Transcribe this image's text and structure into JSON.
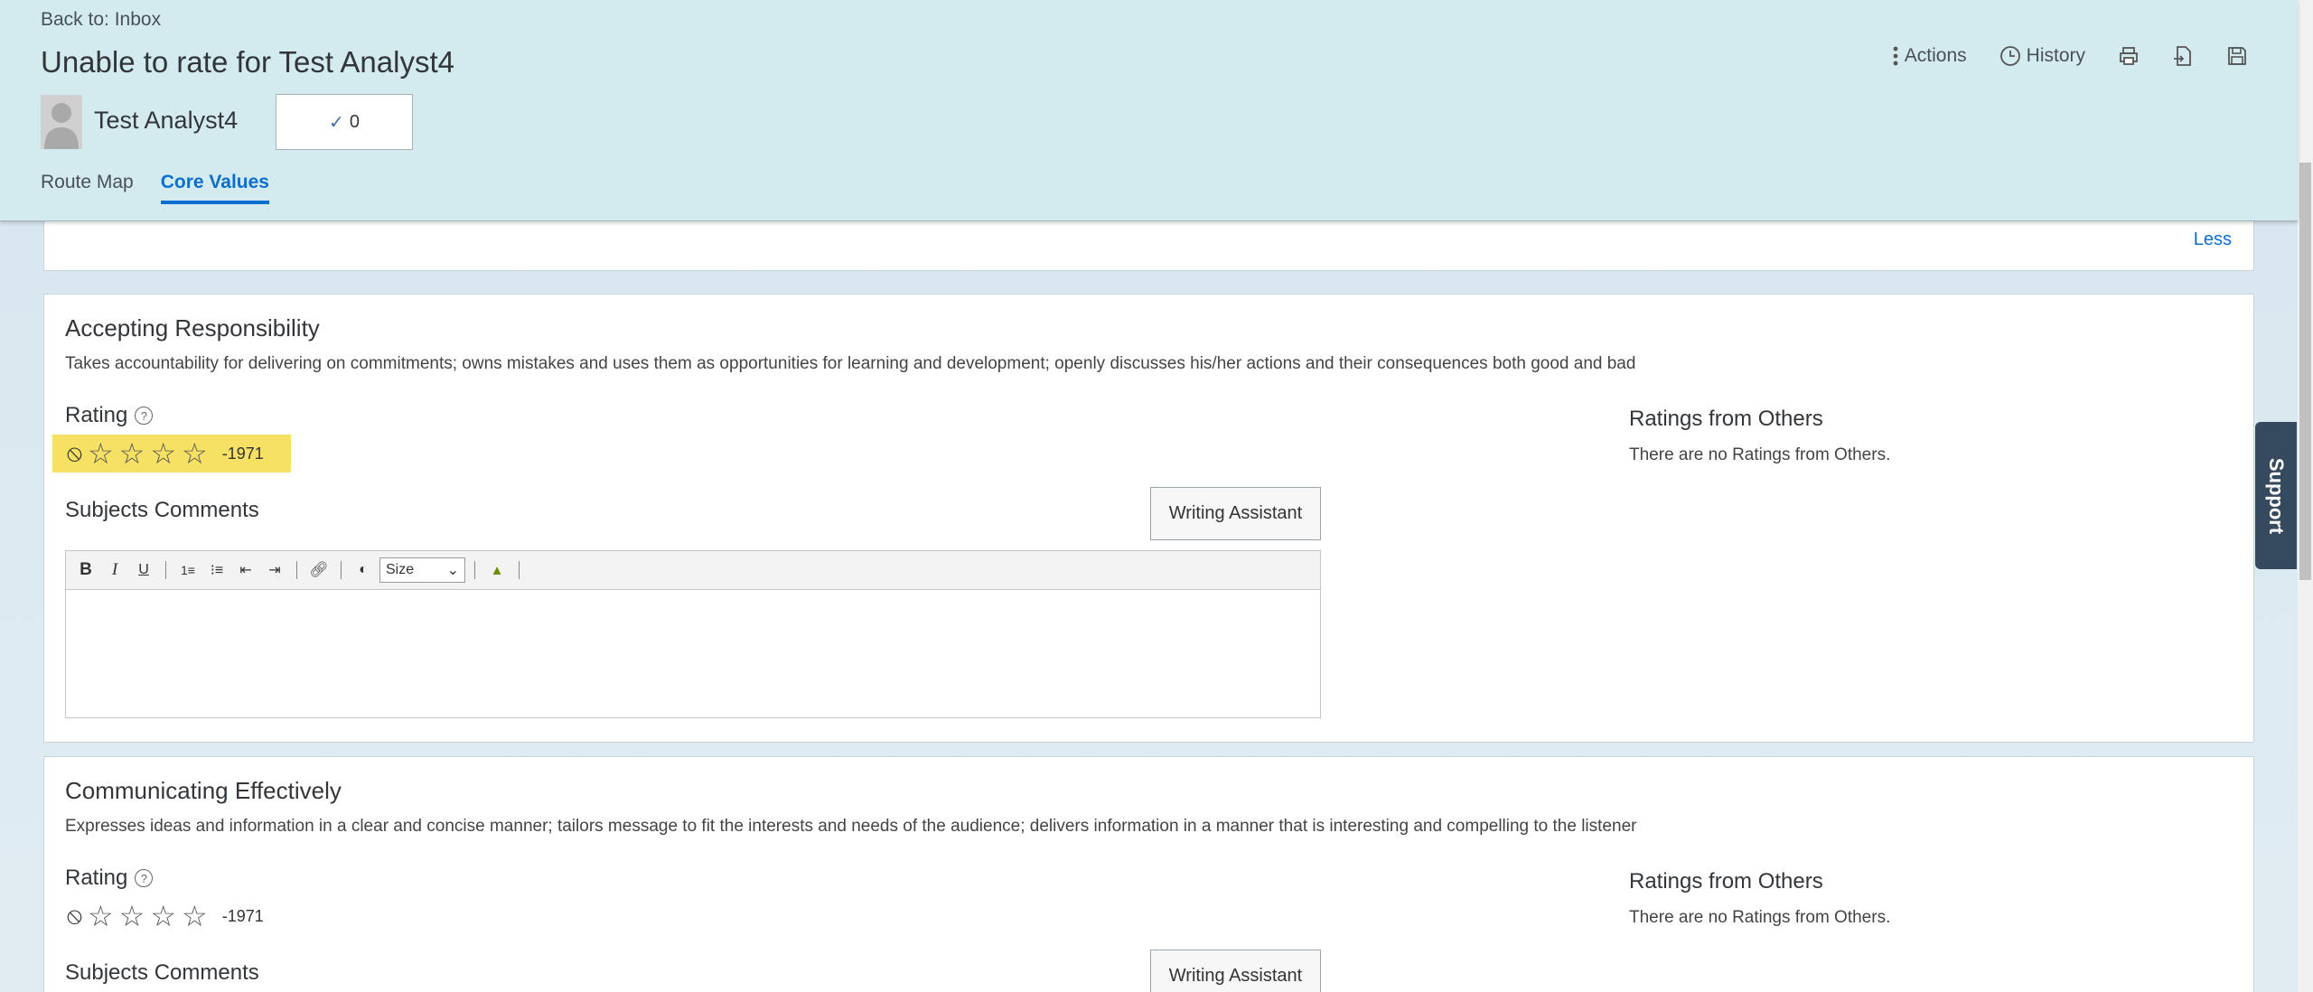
{
  "header": {
    "back_link": "Back to: Inbox",
    "title": "Unable to rate for Test Analyst4",
    "user_name": "Test Analyst4",
    "check_count": "0",
    "tabs": [
      {
        "label": "Route Map",
        "active": false
      },
      {
        "label": "Core Values",
        "active": true
      }
    ],
    "toolbar": {
      "actions_label": "Actions",
      "history_label": "History",
      "print_icon": "print-icon",
      "export_icon": "export-icon",
      "save_icon": "save-icon"
    }
  },
  "top_card": {
    "less_label": "Less"
  },
  "sections": [
    {
      "title": "Accepting Responsibility",
      "description": "Takes accountability for delivering on commitments; owns mistakes and uses them as opportunities for learning and development; openly discusses his/her actions and their consequences both good and bad",
      "rating_label": "Rating",
      "rating_value": "-1971",
      "stars": 5,
      "highlighted": true,
      "comments_label": "Subjects Comments",
      "writing_assistant": "Writing Assistant",
      "size_select": "Size",
      "others_title": "Ratings from Others",
      "others_text": "There are no Ratings from Others."
    },
    {
      "title": "Communicating Effectively",
      "description": "Expresses ideas and information in a clear and concise manner; tailors message to fit the interests and needs of the audience; delivers information in a manner that is interesting and compelling to the listener",
      "rating_label": "Rating",
      "rating_value": "-1971",
      "stars": 5,
      "highlighted": false,
      "comments_label": "Subjects Comments",
      "writing_assistant": "Writing Assistant",
      "others_title": "Ratings from Others",
      "others_text": "There are no Ratings from Others."
    }
  ],
  "support_label": "Support",
  "colors": {
    "header_bg": "#d3ebef",
    "accent": "#0a6ed1",
    "highlight": "#f6e164",
    "support_bg": "#354a5f"
  }
}
